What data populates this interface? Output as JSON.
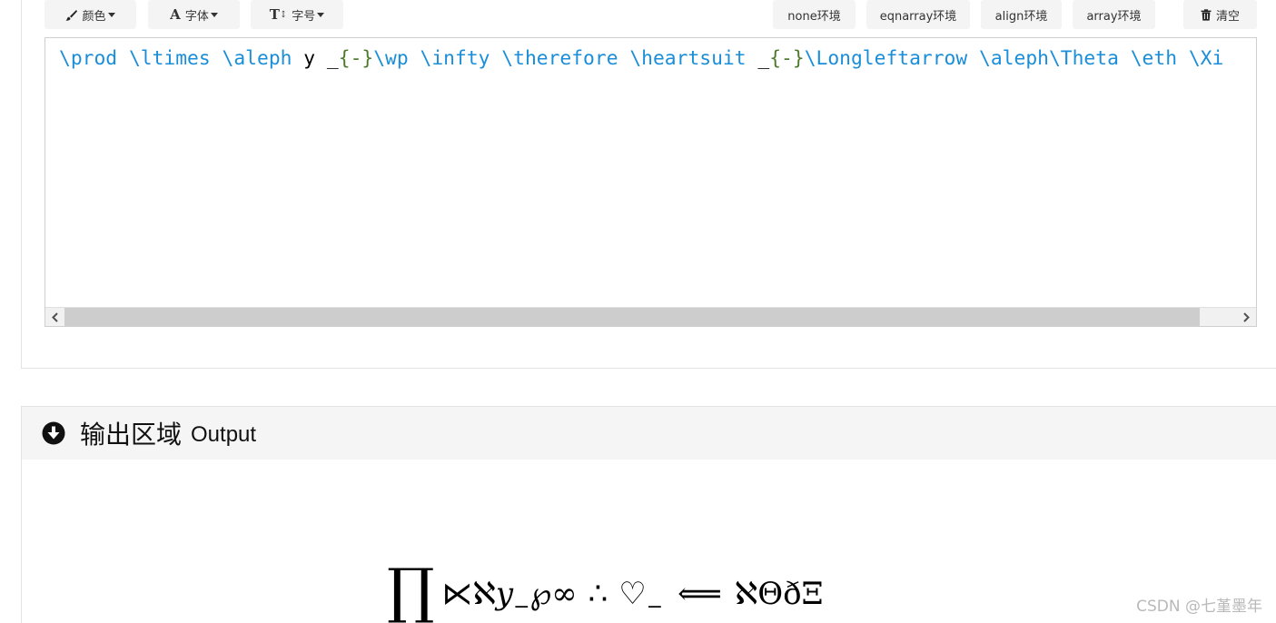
{
  "toolbar": {
    "color_label": "颜色",
    "font_label": "字体",
    "size_label": "字号",
    "env_none": "none环境",
    "env_eqnarray": "eqnarray环境",
    "env_align": "align环境",
    "env_array": "array环境",
    "clear_label": "清空"
  },
  "editor": {
    "tokens": [
      {
        "t": "cmd",
        "v": "\\prod"
      },
      {
        "t": "plain",
        "v": " "
      },
      {
        "t": "cmd",
        "v": "\\ltimes"
      },
      {
        "t": "plain",
        "v": " "
      },
      {
        "t": "cmd",
        "v": "\\aleph"
      },
      {
        "t": "plain",
        "v": " y _"
      },
      {
        "t": "brace",
        "v": "{-}"
      },
      {
        "t": "cmd",
        "v": "\\wp"
      },
      {
        "t": "plain",
        "v": " "
      },
      {
        "t": "cmd",
        "v": "\\infty"
      },
      {
        "t": "plain",
        "v": " "
      },
      {
        "t": "cmd",
        "v": "\\therefore"
      },
      {
        "t": "plain",
        "v": " "
      },
      {
        "t": "cmd",
        "v": "\\heartsuit"
      },
      {
        "t": "plain",
        "v": " _"
      },
      {
        "t": "brace",
        "v": "{-}"
      },
      {
        "t": "cmd",
        "v": "\\Longleftarrow"
      },
      {
        "t": "plain",
        "v": " "
      },
      {
        "t": "cmd",
        "v": "\\aleph"
      },
      {
        "t": "cmd",
        "v": "\\Theta"
      },
      {
        "t": "plain",
        "v": " "
      },
      {
        "t": "cmd",
        "v": "\\eth"
      },
      {
        "t": "plain",
        "v": " "
      },
      {
        "t": "cmd",
        "v": "\\Xi"
      }
    ]
  },
  "output": {
    "title_zh": "输出区域",
    "title_en": "Output",
    "formula": {
      "prod": "∏",
      "ltimes": "⋉",
      "aleph": "ℵ",
      "y": "y",
      "sub": "−",
      "wp": "℘",
      "infty": "∞",
      "therefore": "∴",
      "heart": "♡",
      "sub2": "−",
      "arrow": "⟸",
      "aleph2": "ℵ",
      "theta": "Θ",
      "eth": "ð",
      "xi": "Ξ"
    }
  },
  "watermark": "CSDN @七堇墨年",
  "colors": {
    "command": "#1a8ed8",
    "brace": "#4e7a2e",
    "header_bg": "#f5f5f5",
    "button_bg": "#f4f4f4"
  },
  "icons": {
    "color": "brush-icon",
    "font": "font-A-icon",
    "size": "text-size-icon",
    "clear": "trash-icon",
    "output": "circle-arrow-down-icon",
    "scroll_left": "chevron-left-icon",
    "scroll_right": "chevron-right-icon"
  }
}
